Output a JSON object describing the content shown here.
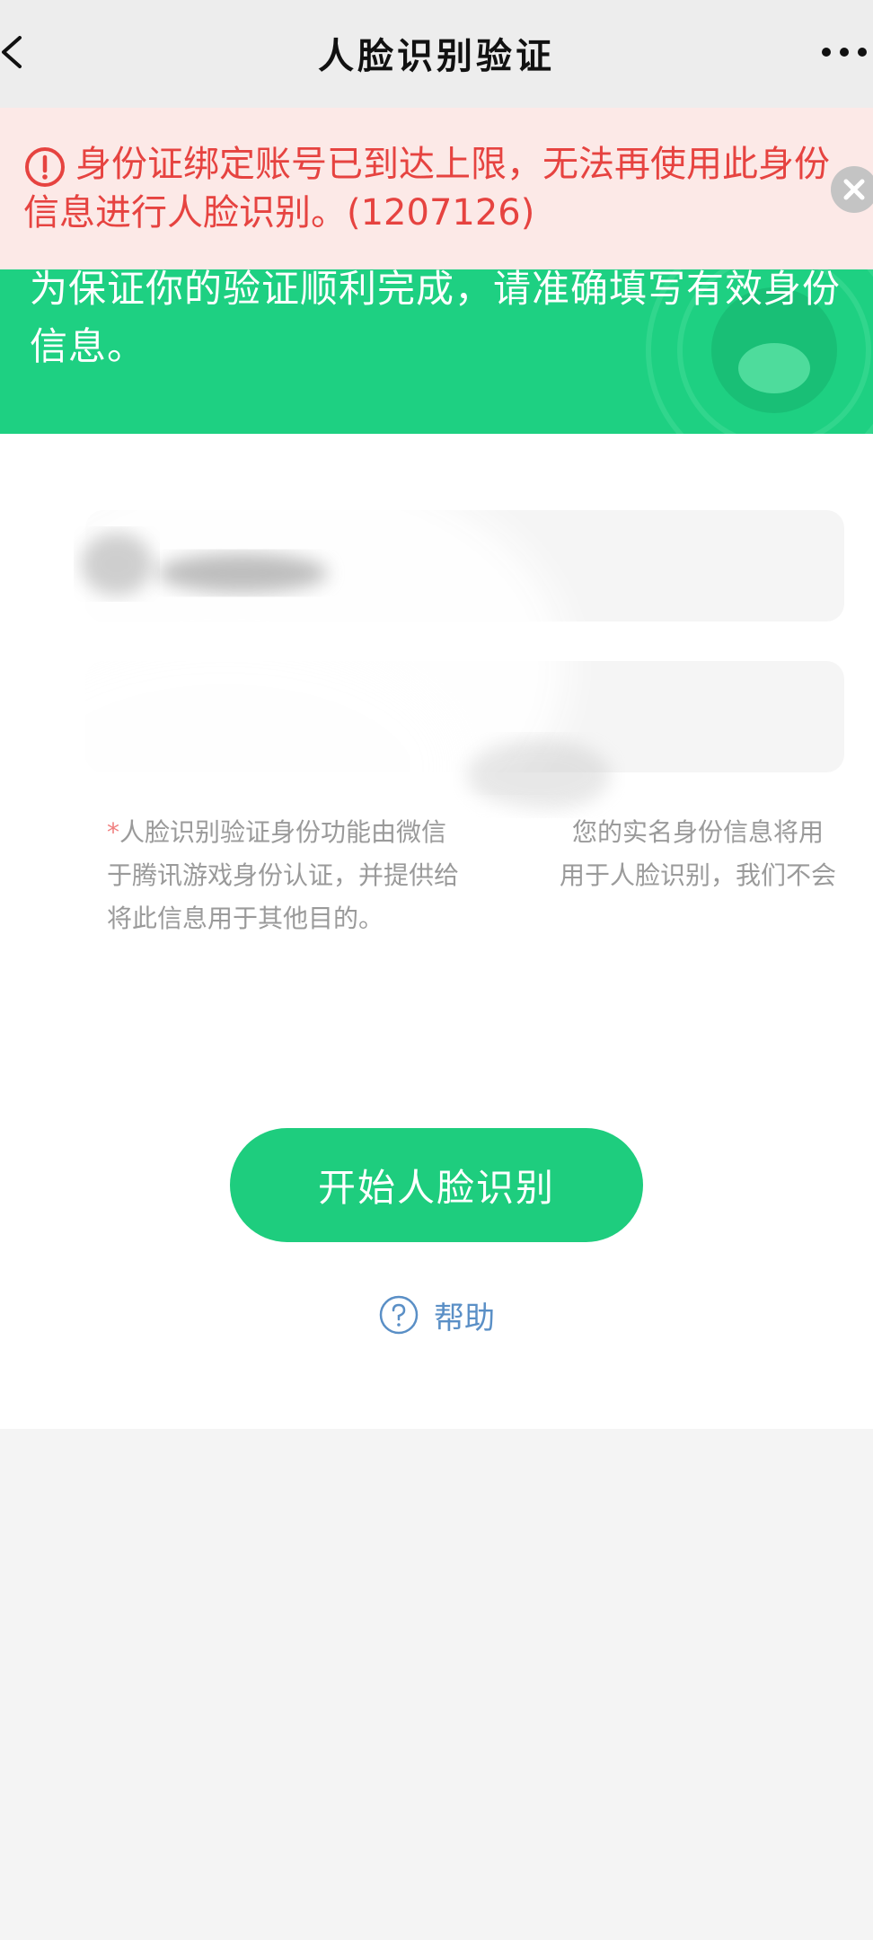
{
  "nav": {
    "title": "人脸识别验证",
    "back_icon": "chevron-left-icon",
    "more_icon": "more-dots-icon"
  },
  "error": {
    "message": "身份证绑定账号已到达上限，无法再使用此身份信息进行人脸识别。(1207126)",
    "icon": "alert-circle-icon",
    "color": "#e64340",
    "background": "#fce9e7"
  },
  "banner": {
    "text": "为保证你的验证顺利完成，请准确填写有效身份信息。",
    "color": "#1ed082"
  },
  "form": {
    "name_value": "",
    "id_value": ""
  },
  "disclaimer": {
    "star": "*",
    "text": "人脸识别验证身份功能由微信　　　　　您的实名身份信息将用于腾讯游戏身份认证，并提供给　　　　用于人脸识别，我们不会将此信息用于其他目的。"
  },
  "actions": {
    "start_label": "开始人脸识别",
    "help_label": "帮助",
    "accent": "#1ecd7e",
    "link_color": "#5a8fc6"
  }
}
